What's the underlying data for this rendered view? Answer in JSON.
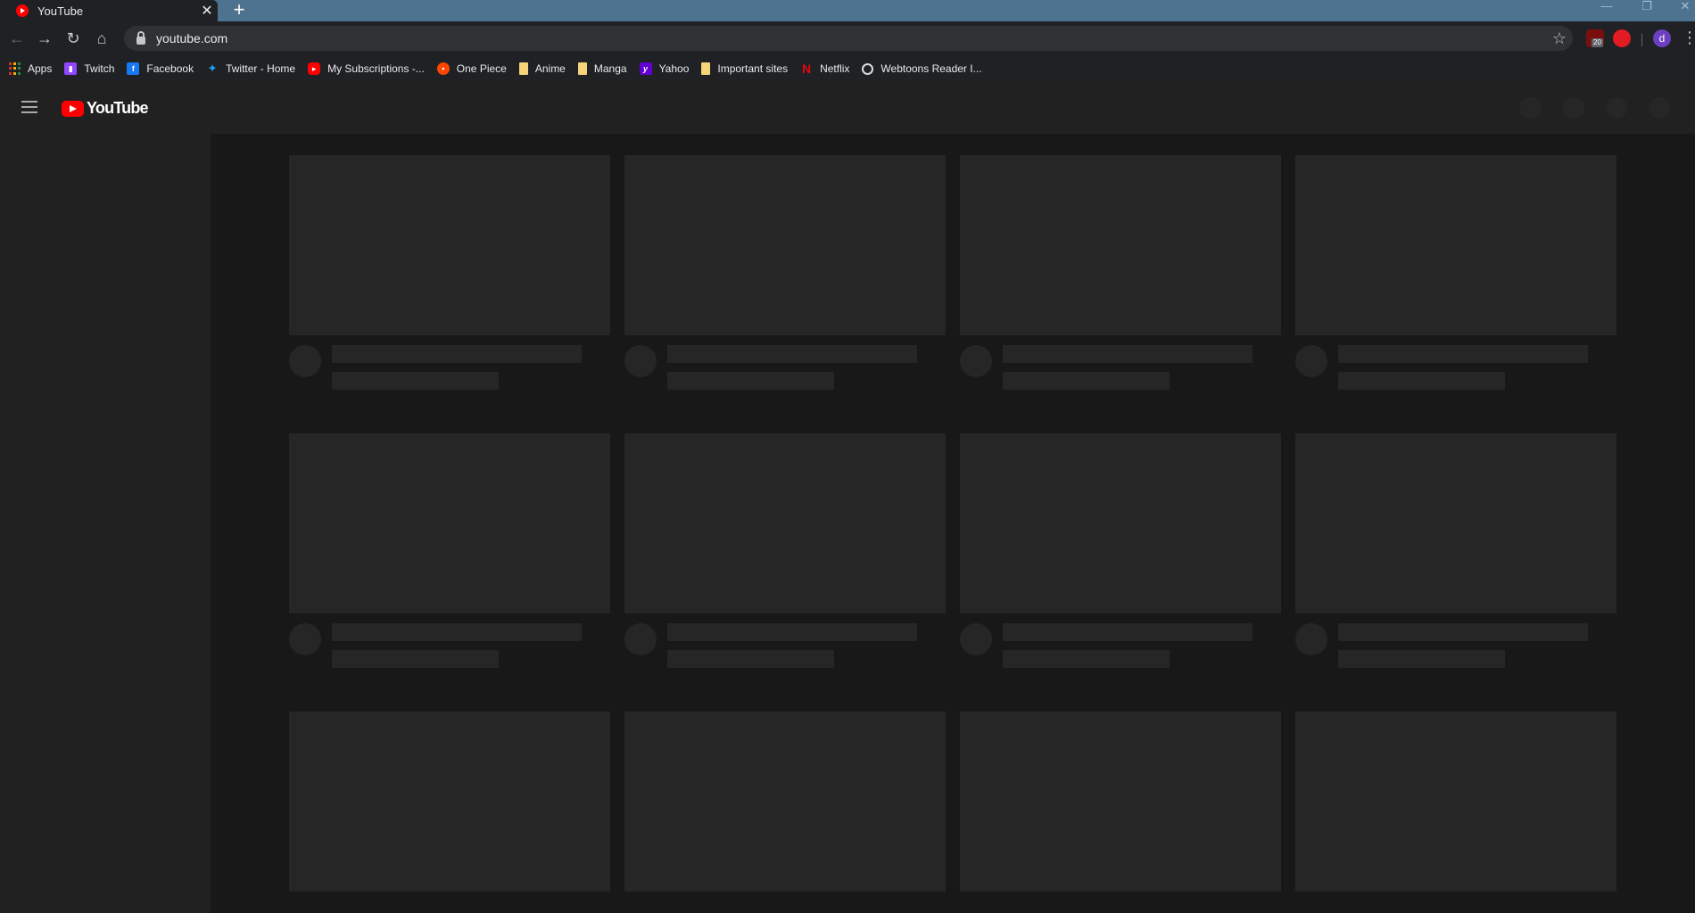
{
  "tab": {
    "title": "YouTube",
    "close": "✕",
    "new_tab": "+"
  },
  "window_controls": {
    "minimize": "—",
    "restore": "❐",
    "close": "✕"
  },
  "toolbar": {
    "back": "←",
    "forward": "→",
    "reload": "↻",
    "home": "⌂",
    "url": "youtube.com",
    "star": "☆",
    "ublock_badge": "20",
    "avatar_letter": "d",
    "menu": "⋮"
  },
  "bookmarks": [
    {
      "label": "Apps",
      "icon": "apps-icon"
    },
    {
      "label": "Twitch",
      "icon": "twitch-icon"
    },
    {
      "label": "Facebook",
      "icon": "facebook-icon"
    },
    {
      "label": "Twitter - Home",
      "icon": "twitter-icon"
    },
    {
      "label": "My Subscriptions -...",
      "icon": "youtube-icon"
    },
    {
      "label": "One Piece",
      "icon": "reddit-icon"
    },
    {
      "label": "Anime",
      "icon": "folder-icon"
    },
    {
      "label": "Manga",
      "icon": "folder-icon"
    },
    {
      "label": "Yahoo",
      "icon": "yahoo-icon"
    },
    {
      "label": "Important sites",
      "icon": "folder-icon"
    },
    {
      "label": "Netflix",
      "icon": "netflix-icon"
    },
    {
      "label": "Webtoons Reader I...",
      "icon": "globe-icon"
    }
  ],
  "youtube": {
    "logo_text": "YouTube"
  },
  "colors": {
    "tabstrip": "#4d7391",
    "youtube_red": "#ff0000",
    "skeleton": "#262626",
    "background": "#181818"
  }
}
